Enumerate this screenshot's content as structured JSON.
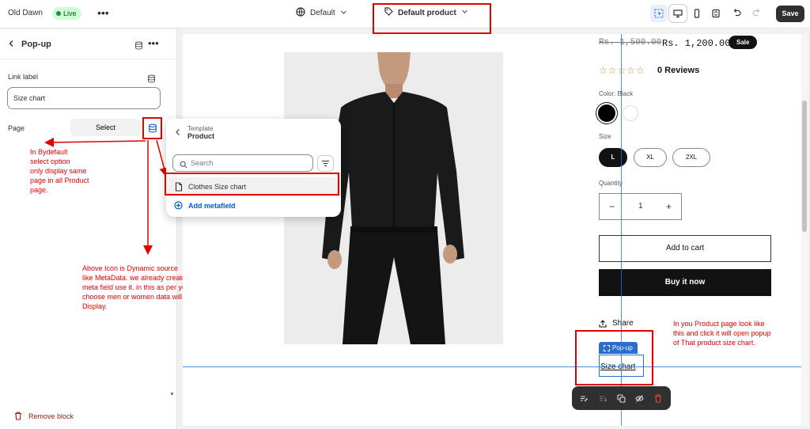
{
  "topbar": {
    "store_name": "Old Dawn",
    "status": "Live",
    "more": "•••",
    "theme_label": "Default",
    "template_label": "Default product",
    "save": "Save"
  },
  "sidebar": {
    "title": "Pop-up",
    "link_label": "Link label",
    "link_value": "Size chart",
    "page_label": "Page",
    "select_label": "Select",
    "remove_block": "Remove block"
  },
  "popover": {
    "overline": "Template",
    "title": "Product",
    "search_placeholder": "Search",
    "item": "Clothes Size chart",
    "add_metafield": "Add metafield"
  },
  "annotations": {
    "note1": "In Bydefault\nselect option\nonly display same\npage in all Product\npage.",
    "note2": "Above Icon is Dynamic source\nlike MetaData. we already created\nmeta field use it. in this as per you\nchoose men or women data will be\nDisplay.",
    "note3": "In you Product page look like\nthis and click it will open popup\nof That product size chart."
  },
  "product": {
    "price_old": "Rs. 1,500.00",
    "price_new": "Rs. 1,200.00",
    "sale": "Sale",
    "stars": "☆☆☆☆☆",
    "reviews": "0 Reviews",
    "color_label": "Color: Black",
    "size_label": "Size",
    "sizes": [
      "L",
      "XL",
      "2XL"
    ],
    "quantity_label": "Quantity",
    "quantity_value": "1",
    "add_to_cart": "Add to cart",
    "buy_now": "Buy it now",
    "share": "Share",
    "popup_tag": "Pop-up",
    "size_chart_link": "Size chart"
  },
  "colors": {
    "annotation_red": "#e30000",
    "selection_blue": "#2c6ecb",
    "live_green": "#cdfed4"
  }
}
